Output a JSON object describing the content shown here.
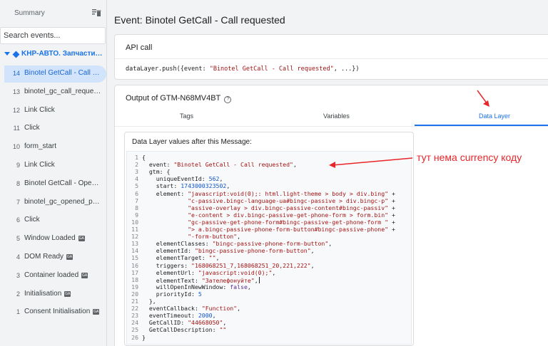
{
  "sidebar": {
    "title": "Summary",
    "search_placeholder": "Search events...",
    "container_label": "KHP-АВТО. Запчастини для",
    "events": [
      {
        "num": "14",
        "name": "Binotel GetCall - Call requested",
        "active": true,
        "badge": ""
      },
      {
        "num": "13",
        "name": "binotel_gc_call_requested",
        "active": false,
        "badge": ""
      },
      {
        "num": "12",
        "name": "Link Click",
        "active": false,
        "badge": ""
      },
      {
        "num": "11",
        "name": "Click",
        "active": false,
        "badge": ""
      },
      {
        "num": "10",
        "name": "form_start",
        "active": false,
        "badge": ""
      },
      {
        "num": "9",
        "name": "Link Click",
        "active": false,
        "badge": ""
      },
      {
        "num": "8",
        "name": "Binotel GetCall - Opened",
        "active": false,
        "badge": ""
      },
      {
        "num": "7",
        "name": "binotel_gc_opened_passive",
        "active": false,
        "badge": ""
      },
      {
        "num": "6",
        "name": "Click",
        "active": false,
        "badge": ""
      },
      {
        "num": "5",
        "name": "Window Loaded",
        "active": false,
        "badge": "GA"
      },
      {
        "num": "4",
        "name": "DOM Ready",
        "active": false,
        "badge": "GA"
      },
      {
        "num": "3",
        "name": "Container loaded",
        "active": false,
        "badge": "GA"
      },
      {
        "num": "2",
        "name": "Initialisation",
        "active": false,
        "badge": "GA"
      },
      {
        "num": "1",
        "name": "Consent Initialisation",
        "active": false,
        "badge": "GA"
      }
    ]
  },
  "main": {
    "title": "Event: Binotel GetCall - Call requested",
    "api_call": {
      "heading": "API call",
      "code_prefix": "dataLayer.push({event: ",
      "code_string": "\"Binotel GetCall - Call requested\"",
      "code_suffix": ", ...})"
    },
    "output": {
      "heading": "Output of GTM-N68MV4BT",
      "help_icon": "?",
      "tabs": [
        {
          "label": "Tags",
          "active": false
        },
        {
          "label": "Variables",
          "active": false
        },
        {
          "label": "Data Layer",
          "active": true
        }
      ],
      "data_layer_heading": "Data Layer values after this Message:"
    },
    "code_lines": [
      {
        "n": "1",
        "t": "{"
      },
      {
        "n": "2",
        "t": "  event: \"Binotel GetCall - Call requested\","
      },
      {
        "n": "3",
        "t": "  gtm: {"
      },
      {
        "n": "4",
        "t": "    uniqueEventId: 562,"
      },
      {
        "n": "5",
        "t": "    start: 1743000323502,"
      },
      {
        "n": "6",
        "t": "    element: \"javascript:void(0);: html.light-theme > body > div.bing\" +"
      },
      {
        "n": "7",
        "t": "             \"c-passive.bingc-language-ua#bingc-passive > div.bingc-p\" +"
      },
      {
        "n": "8",
        "t": "             \"assive-overlay > div.bingc-passive-content#bingc-passiv\" +"
      },
      {
        "n": "9",
        "t": "             \"e-content > div.bingc-passive-get-phone-form > form.bin\" +"
      },
      {
        "n": "10",
        "t": "             \"gc-passive-get-phone-form#bingc-passive-get-phone-form \" +"
      },
      {
        "n": "11",
        "t": "             \"> a.bingc-passive-phone-form-button#bingc-passive-phone\" +"
      },
      {
        "n": "12",
        "t": "             \"-form-button\","
      },
      {
        "n": "13",
        "t": "    elementClasses: \"bingc-passive-phone-form-button\","
      },
      {
        "n": "14",
        "t": "    elementId: \"bingc-passive-phone-form-button\","
      },
      {
        "n": "15",
        "t": "    elementTarget: \"\","
      },
      {
        "n": "16",
        "t": "    triggers: \"168068251_7,168068251_20,221,222\","
      },
      {
        "n": "17",
        "t": "    elementUrl: \"javascript:void(0);\","
      },
      {
        "n": "18",
        "t": "    elementText: \"Зателефонуйте\","
      },
      {
        "n": "19",
        "t": "    willOpenInNewWindow: false,"
      },
      {
        "n": "20",
        "t": "    priorityId: 5"
      },
      {
        "n": "21",
        "t": "  },"
      },
      {
        "n": "22",
        "t": "  eventCallback: \"Function\","
      },
      {
        "n": "23",
        "t": "  eventTimeout: 2000,"
      },
      {
        "n": "24",
        "t": "  GetCallID: \"44668050\","
      },
      {
        "n": "25",
        "t": "  GetCallDescription: \"\""
      },
      {
        "n": "26",
        "t": "}"
      }
    ]
  },
  "annotation": {
    "text": "тут нема currency коду",
    "color": "#e8252a"
  },
  "colors": {
    "accent": "#1a73e8",
    "active_bg": "#d2e3fc",
    "string": "#a31515",
    "number": "#1155cc"
  }
}
